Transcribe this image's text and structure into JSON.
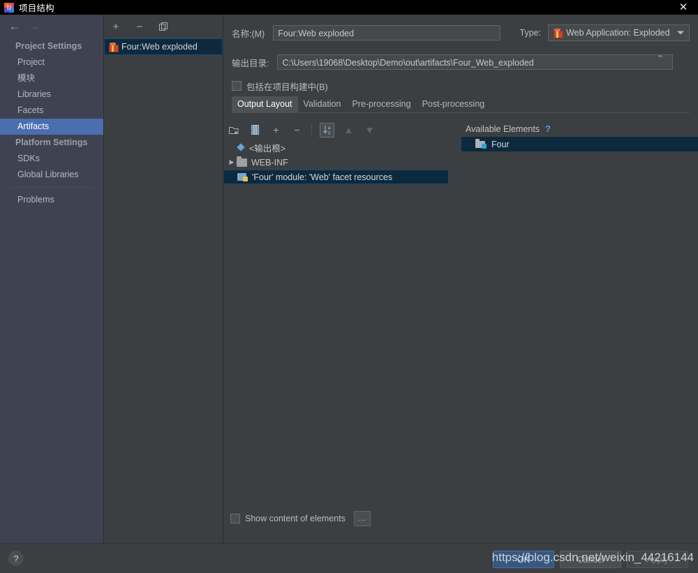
{
  "window": {
    "title": "项目结构",
    "app_icon": "intellij-idea-icon",
    "close_label": "✕"
  },
  "nav": {
    "back_label": "←",
    "forward_label": "→"
  },
  "sidebar": {
    "groups": [
      {
        "label": "Project Settings",
        "items": [
          {
            "label": "Project",
            "selected": false
          },
          {
            "label": "模块",
            "selected": false
          },
          {
            "label": "Libraries",
            "selected": false
          },
          {
            "label": "Facets",
            "selected": false
          },
          {
            "label": "Artifacts",
            "selected": true
          }
        ]
      },
      {
        "label": "Platform Settings",
        "items": [
          {
            "label": "SDKs",
            "selected": false
          },
          {
            "label": "Global Libraries",
            "selected": false
          }
        ]
      }
    ],
    "problems_label": "Problems"
  },
  "artifact_list": {
    "toolbar": {
      "add_label": "+",
      "remove_label": "−",
      "copy_label": "copy-icon"
    },
    "items": [
      {
        "label": "Four:Web exploded",
        "selected": true,
        "icon": "artifact-icon"
      }
    ]
  },
  "editor": {
    "name_label": "名称:(M)",
    "name_mnemonic": "M",
    "name_value": "Four:Web exploded",
    "type_label": "Type:",
    "type_value": "Web Application: Exploded",
    "type_icon": "artifact-icon",
    "output_label": "输出目录:",
    "output_value": "C:\\Users\\19068\\Desktop\\Demo\\out\\artifacts\\Four_Web_exploded",
    "output_browse_icon": "folder-icon",
    "include_in_build_label": "包括在项目构建中(B)",
    "include_in_build_mnemonic": "B",
    "include_in_build_checked": false,
    "tabs": [
      {
        "label": "Output Layout",
        "active": true
      },
      {
        "label": "Validation",
        "active": false
      },
      {
        "label": "Pre-processing",
        "active": false
      },
      {
        "label": "Post-processing",
        "active": false
      }
    ]
  },
  "tree_toolbar": {
    "buttons": [
      {
        "name": "add-directory-icon",
        "glyph": "add-folder",
        "enabled": true
      },
      {
        "name": "add-archive-icon",
        "glyph": "archive",
        "enabled": true
      },
      {
        "name": "add-copy-of-icon",
        "glyph": "+",
        "enabled": true
      },
      {
        "name": "remove-icon",
        "glyph": "−",
        "enabled": true
      },
      {
        "name": "sort-alphabetically-icon",
        "glyph": "sort-az",
        "enabled": true,
        "toggled": true
      },
      {
        "name": "move-up-icon",
        "glyph": "▲",
        "enabled": false
      },
      {
        "name": "move-down-icon",
        "glyph": "▼",
        "enabled": false
      }
    ]
  },
  "output_tree": {
    "rows": [
      {
        "label": "<输出根>",
        "icon": "output-root-icon",
        "indent": 0,
        "twisty": "",
        "selected": false
      },
      {
        "label": "WEB-INF",
        "icon": "folder-icon",
        "indent": 0,
        "twisty": "▶",
        "selected": false
      },
      {
        "label": "'Four' module: 'Web' facet resources",
        "icon": "module-output-icon",
        "indent": 1,
        "twisty": "",
        "selected": true
      }
    ]
  },
  "available_elements": {
    "title": "Available Elements",
    "help_glyph": "?",
    "rows": [
      {
        "label": "Four",
        "icon": "module-folder-icon",
        "selected": true
      }
    ]
  },
  "bottom": {
    "show_content_label": "Show content of elements",
    "show_content_checked": false,
    "more_button_label": "..."
  },
  "footer": {
    "help_label": "?",
    "buttons": [
      {
        "label": "OK",
        "style": "primary"
      },
      {
        "label": "Cancel",
        "style": "normal"
      },
      {
        "label": "Apply",
        "style": "dim"
      }
    ]
  },
  "watermark": {
    "text": "https://blog.csdn.net/weixin_44216144"
  }
}
